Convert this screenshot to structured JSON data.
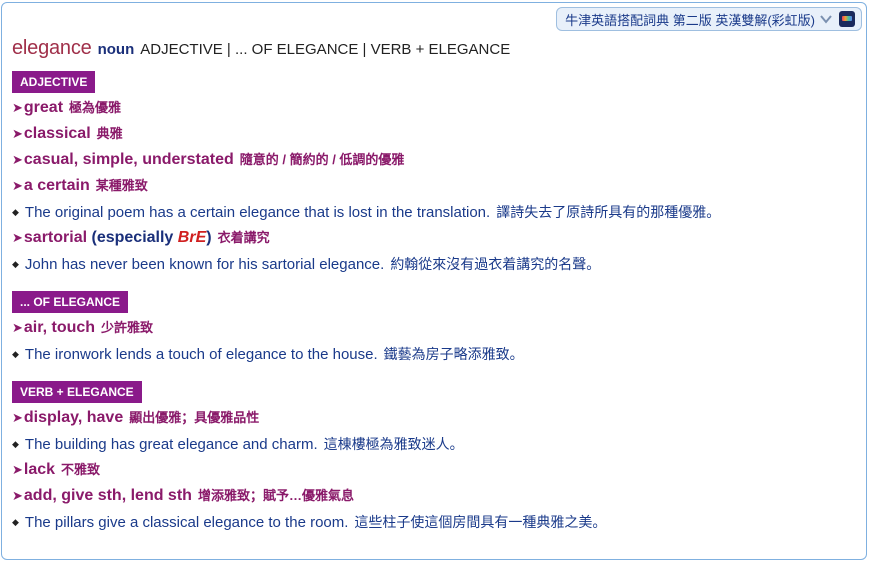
{
  "dictionary_selector": {
    "label": "牛津英語搭配詞典 第二版 英漢雙解(彩虹版)"
  },
  "entry": {
    "headword": "elegance",
    "pos": "noun",
    "sections_list": "ADJECTIVE | ... OF ELEGANCE | VERB + ELEGANCE"
  },
  "sections": [
    {
      "label": "ADJECTIVE",
      "items": [
        {
          "type": "coll",
          "text": "great",
          "tr": "極為優雅"
        },
        {
          "type": "coll",
          "text": "classical",
          "tr": "典雅"
        },
        {
          "type": "coll",
          "text": "casual, simple, understated",
          "tr": "隨意的 / 簡約的 / 低調的優雅"
        },
        {
          "type": "coll",
          "text": "a certain",
          "tr": "某種雅致"
        },
        {
          "type": "ex",
          "text": "The original poem has a certain elegance that is lost in the translation.",
          "tr": "譯詩失去了原詩所具有的那種優雅。"
        },
        {
          "type": "coll",
          "text": "sartorial",
          "note_open": " (",
          "note_especially": "especially ",
          "note_bre": "BrE",
          "note_close": ")",
          "tr": "衣着講究"
        },
        {
          "type": "ex",
          "text": "John has never been known for his sartorial elegance.",
          "tr": "約翰從來沒有過衣着講究的名聲。"
        }
      ]
    },
    {
      "label": "... OF ELEGANCE",
      "items": [
        {
          "type": "coll",
          "text": "air, touch",
          "tr": "少許雅致"
        },
        {
          "type": "ex",
          "text": "The ironwork lends a touch of elegance to the house.",
          "tr": "鐵藝為房子略添雅致。"
        }
      ]
    },
    {
      "label": "VERB + ELEGANCE",
      "items": [
        {
          "type": "coll",
          "text": "display, have",
          "tr": "顯出優雅；具優雅品性"
        },
        {
          "type": "ex",
          "text": "The building has great elegance and charm.",
          "tr": "這棟樓極為雅致迷人。"
        },
        {
          "type": "coll",
          "text": "lack",
          "tr": "不雅致"
        },
        {
          "type": "coll",
          "text": "add, give sth, lend sth",
          "tr": "增添雅致；賦予…優雅氣息"
        },
        {
          "type": "ex",
          "text": "The pillars give a classical elegance to the room.",
          "tr": "這些柱子使這個房間具有一種典雅之美。"
        }
      ]
    }
  ],
  "glyphs": {
    "arrow": "➤",
    "bullet": "◆"
  },
  "colors": {
    "section_bg": "#8a1a8a",
    "headword": "#a0304a",
    "collocate": "#8a1a6a",
    "example": "#1a3a8a",
    "bre": "#d02020"
  }
}
